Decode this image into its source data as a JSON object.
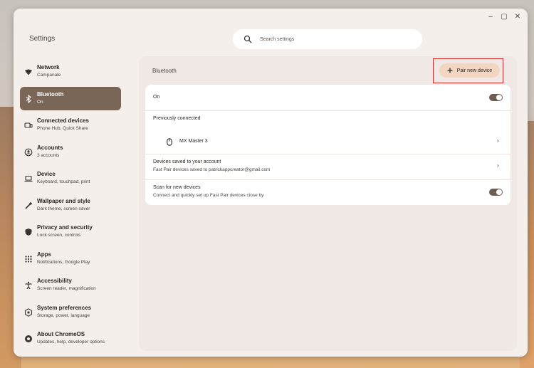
{
  "window": {
    "app_title": "Settings",
    "controls": {
      "minimize": "–",
      "maximize": "▢",
      "close": "✕"
    }
  },
  "search": {
    "placeholder": "Search settings",
    "icon": "search-icon"
  },
  "sidebar": {
    "items": [
      {
        "id": "network",
        "label": "Network",
        "sub": "Campanale",
        "icon": "wifi-icon",
        "active": false
      },
      {
        "id": "bluetooth",
        "label": "Bluetooth",
        "sub": "On",
        "icon": "bluetooth-icon",
        "active": true
      },
      {
        "id": "connected-devices",
        "label": "Connected devices",
        "sub": "Phone Hub, Quick Share",
        "icon": "connected-devices-icon",
        "active": false
      },
      {
        "id": "accounts",
        "label": "Accounts",
        "sub": "3 accounts",
        "icon": "accounts-icon",
        "active": false
      },
      {
        "id": "device",
        "label": "Device",
        "sub": "Keyboard, touchpad, print",
        "icon": "laptop-icon",
        "active": false
      },
      {
        "id": "wallpaper",
        "label": "Wallpaper and style",
        "sub": "Dark theme, screen saver",
        "icon": "paintbrush-icon",
        "active": false
      },
      {
        "id": "privacy",
        "label": "Privacy and security",
        "sub": "Lock screen, controls",
        "icon": "shield-icon",
        "active": false
      },
      {
        "id": "apps",
        "label": "Apps",
        "sub": "Notifications, Google Play",
        "icon": "apps-grid-icon",
        "active": false
      },
      {
        "id": "accessibility",
        "label": "Accessibility",
        "sub": "Screen reader, magnification",
        "icon": "accessibility-icon",
        "active": false
      },
      {
        "id": "system",
        "label": "System preferences",
        "sub": "Storage, power, language",
        "icon": "gear-icon",
        "active": false
      },
      {
        "id": "about",
        "label": "About ChromeOS",
        "sub": "Updates, help, developer options",
        "icon": "chromeos-icon",
        "active": false
      }
    ]
  },
  "main": {
    "title": "Bluetooth",
    "pair_button": {
      "label": "Pair new device",
      "icon": "plus-icon"
    },
    "rows": {
      "on": {
        "label": "On",
        "toggle_on": true
      },
      "previously_connected": {
        "header": "Previously connected"
      },
      "device": {
        "name": "MX Master 3",
        "icon": "mouse-icon"
      },
      "saved": {
        "label": "Devices saved to your account",
        "sub": "Fast Pair devices saved to patrickappcreator@gmail.com"
      },
      "scan": {
        "label": "Scan for new devices",
        "sub": "Connect and quickly set up Fast Pair devices close by",
        "toggle_on": true
      }
    }
  },
  "colors": {
    "accent": "#7a6656",
    "pair_button_bg": "#f2d6c2",
    "highlight_box": "#d22d2d",
    "toggle_track": "#6e5d52"
  }
}
